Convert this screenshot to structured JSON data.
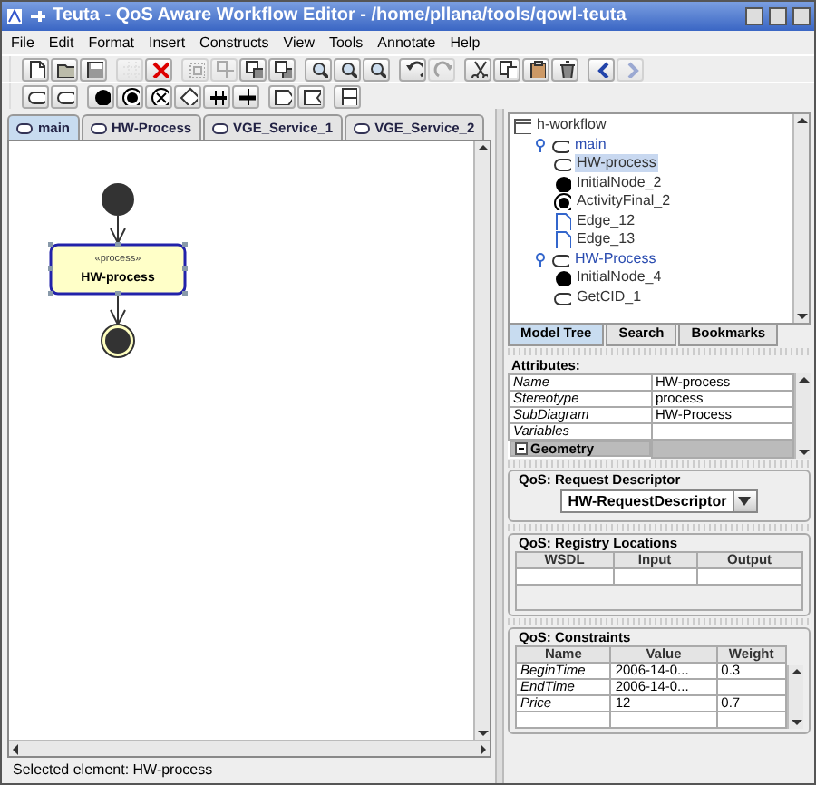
{
  "window": {
    "title": "Teuta - QoS Aware Workflow Editor - /home/pllana/tools/qowl-teuta"
  },
  "menu": [
    "File",
    "Edit",
    "Format",
    "Insert",
    "Constructs",
    "View",
    "Tools",
    "Annotate",
    "Help"
  ],
  "toolbar": [
    {
      "kind": "new",
      "disabled": false
    },
    {
      "kind": "open",
      "disabled": false
    },
    {
      "kind": "save",
      "disabled": false
    },
    {
      "kind": "grid",
      "disabled": true
    },
    {
      "kind": "delete",
      "disabled": false
    },
    {
      "kind": "group",
      "disabled": true
    },
    {
      "kind": "ungroup",
      "disabled": true
    },
    {
      "kind": "front",
      "disabled": false
    },
    {
      "kind": "back",
      "disabled": false
    },
    {
      "kind": "zoom",
      "disabled": false
    },
    {
      "kind": "zoom",
      "disabled": false
    },
    {
      "kind": "zoom",
      "disabled": false
    },
    {
      "kind": "undo",
      "disabled": false
    },
    {
      "kind": "redo",
      "disabled": true
    },
    {
      "kind": "cut",
      "disabled": false
    },
    {
      "kind": "copy",
      "disabled": false
    },
    {
      "kind": "paste",
      "disabled": false
    },
    {
      "kind": "trash",
      "disabled": false
    },
    {
      "kind": "left",
      "disabled": false
    },
    {
      "kind": "right",
      "disabled": true
    }
  ],
  "palette": [
    {
      "kind": "action"
    },
    {
      "kind": "action"
    },
    {
      "kind": "initial"
    },
    {
      "kind": "final"
    },
    {
      "kind": "flowfinal"
    },
    {
      "kind": "decision"
    },
    {
      "kind": "fork"
    },
    {
      "kind": "join"
    },
    {
      "kind": "send"
    },
    {
      "kind": "receive"
    },
    {
      "kind": "partition"
    }
  ],
  "tabs": [
    {
      "label": "main",
      "selected": true
    },
    {
      "label": "HW-Process",
      "selected": false
    },
    {
      "label": "VGE_Service_1",
      "selected": false
    },
    {
      "label": "VGE_Service_2",
      "selected": false
    }
  ],
  "diagram": {
    "action": {
      "stereotype": "«process»",
      "name": "HW-process",
      "selected": true
    }
  },
  "tree": [
    {
      "label": "h-workflow",
      "kind": "workflow",
      "selected": false,
      "children": [
        {
          "label": "main",
          "kind": "action",
          "selected": false,
          "expanded": true,
          "children": [
            {
              "label": "HW-process",
              "kind": "action",
              "selected": true
            },
            {
              "label": "InitialNode_2",
              "kind": "initial",
              "selected": false
            },
            {
              "label": "ActivityFinal_2",
              "kind": "final",
              "selected": false
            },
            {
              "label": "Edge_12",
              "kind": "edge",
              "selected": false
            },
            {
              "label": "Edge_13",
              "kind": "edge",
              "selected": false
            }
          ]
        },
        {
          "label": "HW-Process",
          "kind": "action",
          "selected": false,
          "expanded": true,
          "children": [
            {
              "label": "InitialNode_4",
              "kind": "initial",
              "selected": false
            },
            {
              "label": "GetCID_1",
              "kind": "action",
              "selected": false
            }
          ]
        }
      ]
    }
  ],
  "tree_tabs": [
    {
      "label": "Model Tree",
      "selected": true
    },
    {
      "label": "Search",
      "selected": false
    },
    {
      "label": "Bookmarks",
      "selected": false
    }
  ],
  "attributes": {
    "title": "Attributes:",
    "rows": [
      {
        "name": "Name",
        "value": "HW-process"
      },
      {
        "name": "Stereotype",
        "value": "process"
      },
      {
        "name": "SubDiagram",
        "value": "HW-Process"
      },
      {
        "name": "Variables"
      },
      {
        "name": "Geometry",
        "kind": "group",
        "expanded": true
      }
    ]
  },
  "request_descriptor": {
    "title": "QoS: Request Descriptor",
    "value": "HW-RequestDescriptor"
  },
  "registry": {
    "title": "QoS: Registry Locations",
    "columns": [
      "WSDL",
      "Input",
      "Output"
    ]
  },
  "constraints": {
    "title": "QoS: Constraints",
    "columns": [
      "Name",
      "Value",
      "Weight"
    ],
    "rows": [
      [
        "BeginTime",
        "2006-14-0...",
        "0.3"
      ],
      [
        "EndTime",
        "2006-14-0...",
        ""
      ],
      [
        "Price",
        "12",
        "0.7"
      ]
    ]
  },
  "status_bar": "Selected element: HW-process"
}
